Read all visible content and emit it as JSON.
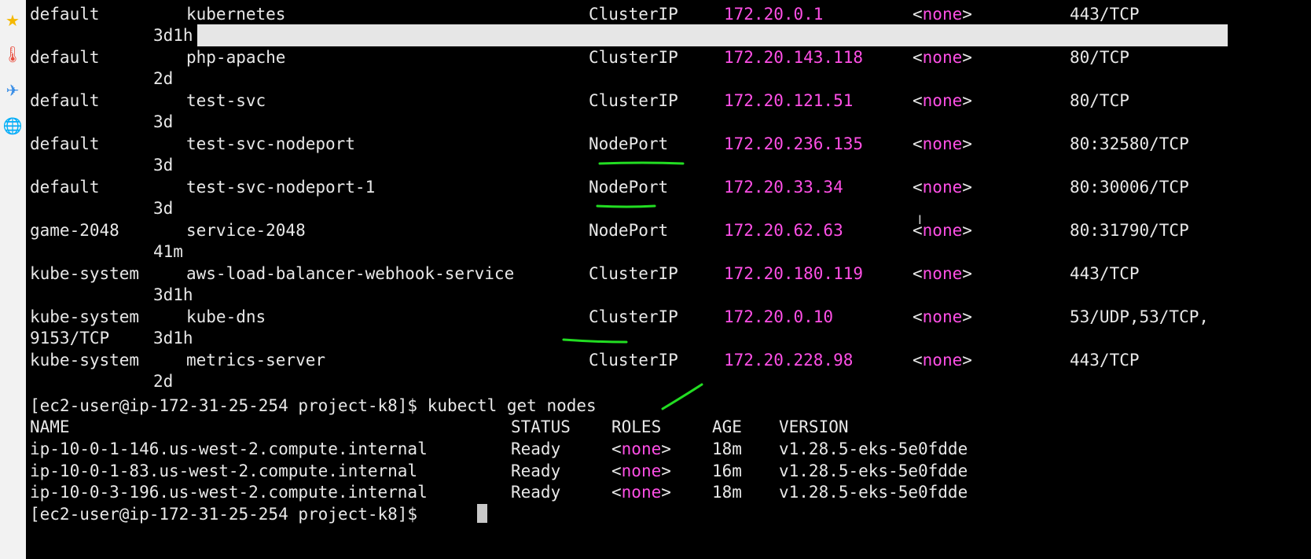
{
  "dock": {
    "icons": [
      {
        "name": "star-icon",
        "glyph": "★",
        "color": "#f5b800"
      },
      {
        "name": "thermometer-icon",
        "glyph": "🌡",
        "color": "#e84c3d"
      },
      {
        "name": "paper-plane-icon",
        "glyph": "✈",
        "color": "#3a8ee6"
      },
      {
        "name": "globe-icon",
        "glyph": "🌐",
        "color": "#f39c12"
      }
    ]
  },
  "services": [
    {
      "namespace": "default",
      "name": "kubernetes",
      "type": "ClusterIP",
      "cluster_ip": "172.20.0.1",
      "external_ip": "none",
      "ports": "443/TCP",
      "age": "3d1h",
      "ports_wrap": ""
    },
    {
      "namespace": "default",
      "name": "php-apache",
      "type": "ClusterIP",
      "cluster_ip": "172.20.143.118",
      "external_ip": "none",
      "ports": "80/TCP",
      "age": "2d",
      "ports_wrap": ""
    },
    {
      "namespace": "default",
      "name": "test-svc",
      "type": "ClusterIP",
      "cluster_ip": "172.20.121.51",
      "external_ip": "none",
      "ports": "80/TCP",
      "age": "3d",
      "ports_wrap": ""
    },
    {
      "namespace": "default",
      "name": "test-svc-nodeport",
      "type": "NodePort",
      "cluster_ip": "172.20.236.135",
      "external_ip": "none",
      "ports": "80:32580/TCP",
      "age": "3d",
      "ports_wrap": ""
    },
    {
      "namespace": "default",
      "name": "test-svc-nodeport-1",
      "type": "NodePort",
      "cluster_ip": "172.20.33.34",
      "external_ip": "none",
      "ports": "80:30006/TCP",
      "age": "3d",
      "ports_wrap": ""
    },
    {
      "namespace": "game-2048",
      "name": "service-2048",
      "type": "NodePort",
      "cluster_ip": "172.20.62.63",
      "external_ip": "none",
      "ports": "80:31790/TCP",
      "age": "41m",
      "ports_wrap": ""
    },
    {
      "namespace": "kube-system",
      "name": "aws-load-balancer-webhook-service",
      "type": "ClusterIP",
      "cluster_ip": "172.20.180.119",
      "external_ip": "none",
      "ports": "443/TCP",
      "age": "3d1h",
      "ports_wrap": ""
    },
    {
      "namespace": "kube-system",
      "name": "kube-dns",
      "type": "ClusterIP",
      "cluster_ip": "172.20.0.10",
      "external_ip": "none",
      "ports": "53/UDP,53/TCP,",
      "age": "3d1h",
      "ports_wrap": "9153/TCP"
    },
    {
      "namespace": "kube-system",
      "name": "metrics-server",
      "type": "ClusterIP",
      "cluster_ip": "172.20.228.98",
      "external_ip": "none",
      "ports": "443/TCP",
      "age": "2d",
      "ports_wrap": ""
    }
  ],
  "prompt": {
    "text": "[ec2-user@ip-172-31-25-254 project-k8]$",
    "command": " kubectl get nodes"
  },
  "nodes_header": {
    "name": "NAME",
    "status": "STATUS",
    "roles": "ROLES",
    "age": "AGE",
    "version": "VERSION"
  },
  "nodes": [
    {
      "name": "ip-10-0-1-146.us-west-2.compute.internal",
      "status": "Ready",
      "roles": "none",
      "age": "18m",
      "version": "v1.28.5-eks-5e0fdde"
    },
    {
      "name": "ip-10-0-1-83.us-west-2.compute.internal",
      "status": "Ready",
      "roles": "none",
      "age": "16m",
      "version": "v1.28.5-eks-5e0fdde"
    },
    {
      "name": "ip-10-0-3-196.us-west-2.compute.internal",
      "status": "Ready",
      "roles": "none",
      "age": "18m",
      "version": "v1.28.5-eks-5e0fdde"
    }
  ],
  "final_prompt": {
    "text": "[ec2-user@ip-172-31-25-254 project-k8]$"
  },
  "colors": {
    "background": "#000000",
    "foreground": "#e8e8e8",
    "ip": "#ff4fe6",
    "annotation": "#22dd22"
  }
}
